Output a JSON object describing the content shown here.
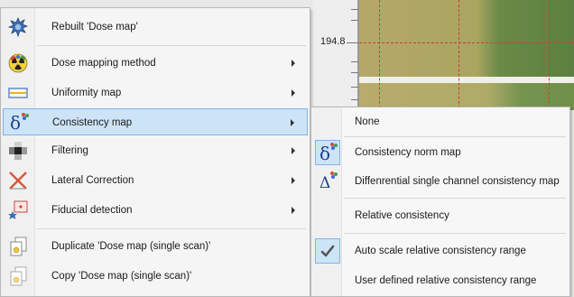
{
  "background": {
    "axis_value": "194.8"
  },
  "menu": {
    "items": [
      {
        "label": "Rebuilt 'Dose map'",
        "icon": "gear-icon",
        "submenu": false
      },
      {
        "label": "Dose mapping method",
        "icon": "radiation-icon",
        "submenu": true
      },
      {
        "label": "Uniformity map",
        "icon": "uniformity-icon",
        "submenu": true
      },
      {
        "label": "Consistency map",
        "icon": "delta-icon",
        "submenu": true,
        "highlighted": true
      },
      {
        "label": "Filtering",
        "icon": "filter-icon",
        "submenu": true
      },
      {
        "label": "Lateral Correction",
        "icon": "lateral-correction-icon",
        "submenu": true
      },
      {
        "label": "Fiducial detection",
        "icon": "fiducial-icon",
        "submenu": true
      },
      {
        "label": "Duplicate 'Dose map (single scan)'",
        "icon": "duplicate-icon",
        "submenu": false
      },
      {
        "label": "Copy 'Dose map (single scan)'",
        "icon": "copy-icon",
        "submenu": false
      }
    ]
  },
  "submenu": {
    "items": [
      {
        "label": "None"
      },
      {
        "label": "Consistency norm map",
        "icon": "delta-icon"
      },
      {
        "label": "Diffenrential single channel consistency map",
        "icon": "triangle-delta-icon"
      },
      {
        "label": "Relative consistency"
      },
      {
        "label": "Auto scale relative consistency range",
        "checked": true
      },
      {
        "label": "User defined relative consistency range"
      }
    ]
  },
  "colors": {
    "highlight": "#cde4f7",
    "highlight_border": "#7eb4ea",
    "delta_blue": "#1d3f8f"
  }
}
